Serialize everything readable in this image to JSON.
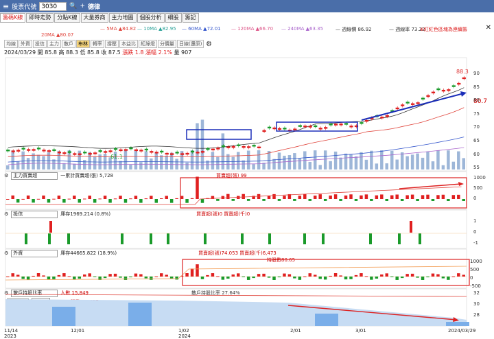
{
  "topbar": {
    "menu_icon": "menu-icon",
    "title": "股票代號",
    "code": "3030",
    "stock_name": "德律"
  },
  "tabs": [
    "籌碼K線",
    "即時走勢",
    "分點K線",
    "大量券商",
    "主力地圖",
    "個股分析",
    "細股",
    "籌記"
  ],
  "ma_row": [
    {
      "label": "5MA ▲84.82",
      "color": "#e0443b"
    },
    {
      "label": "10MA ▲82.95",
      "color": "#2aa198"
    },
    {
      "label": "60MA ▲72.01",
      "color": "#3355cc"
    },
    {
      "label": "120MA ▲66.70",
      "color": "#dd5588"
    },
    {
      "label": "240MA ▲63.35",
      "color": "#aa66cc"
    },
    {
      "label": "週線價 86.92",
      "color": "#333"
    },
    {
      "label": "週線率 73.22",
      "color": "#333"
    }
  ],
  "ma20": "20MA ▲80.07",
  "notice": "⊕紅紅色區塊為連續籌",
  "toolbar": [
    "均線",
    "外資",
    "投信",
    "主力",
    "散戶",
    "布林",
    "轉率",
    "撐壓",
    "本益比",
    "紅綠燈",
    "分價量",
    "日線(還原)"
  ],
  "toolbar_active": "布林",
  "ohlc": "2024/03/29 開 85.8  高 88.3  低 85.8  收 87.5",
  "change": "漲跌 1.8  漲幅 2.1%",
  "vol": "量 907",
  "price_axis": [
    "90",
    "85",
    "80",
    "75",
    "70",
    "65",
    "60",
    "55"
  ],
  "price_tag_high": "88.3",
  "price_tag_low": "61.1",
  "target": "80.7",
  "panels": {
    "main": {
      "name": "主力買賣超",
      "text1": "一累計買賣超(張) 5,728",
      "text2": "買賣超(張) 99",
      "axis": [
        "1000",
        "500",
        "0"
      ]
    },
    "trust": {
      "name": "投信",
      "text1": "庫存1969.214 (0.8%)",
      "text2": "買賣超(張)0 買賣超(千)0",
      "axis": [
        "1",
        "0",
        "-1"
      ]
    },
    "foreign": {
      "name": "外資",
      "text1": "庫存44665.822 (18.9%)",
      "text2": "買賣超(張)74.053 買賣超(千)6,473",
      "text3": "持股數80.65",
      "axis": [
        "1000",
        "500",
        "0",
        "-500"
      ]
    },
    "holder": {
      "name": "散戶持股比率",
      "text1": "人數 15,849",
      "text2": "張數 65,427",
      "text3": "散戶持股比率 27.64%",
      "select": "100",
      "select2": "張以下",
      "axis": [
        "32",
        "30",
        "28"
      ]
    }
  },
  "x_labels": [
    {
      "label": "11/14",
      "sub": "2023"
    },
    {
      "label": "12/01",
      "sub": ""
    },
    {
      "label": "1/02",
      "sub": "2024"
    },
    {
      "label": "2/01",
      "sub": ""
    },
    {
      "label": "3/01",
      "sub": ""
    },
    {
      "label": "2024/03/29",
      "sub": ""
    }
  ],
  "colors": {
    "up": "#e02020",
    "down": "#1a9a2a",
    "vol": "#9db6d8",
    "accent": "#4a6ea9"
  }
}
